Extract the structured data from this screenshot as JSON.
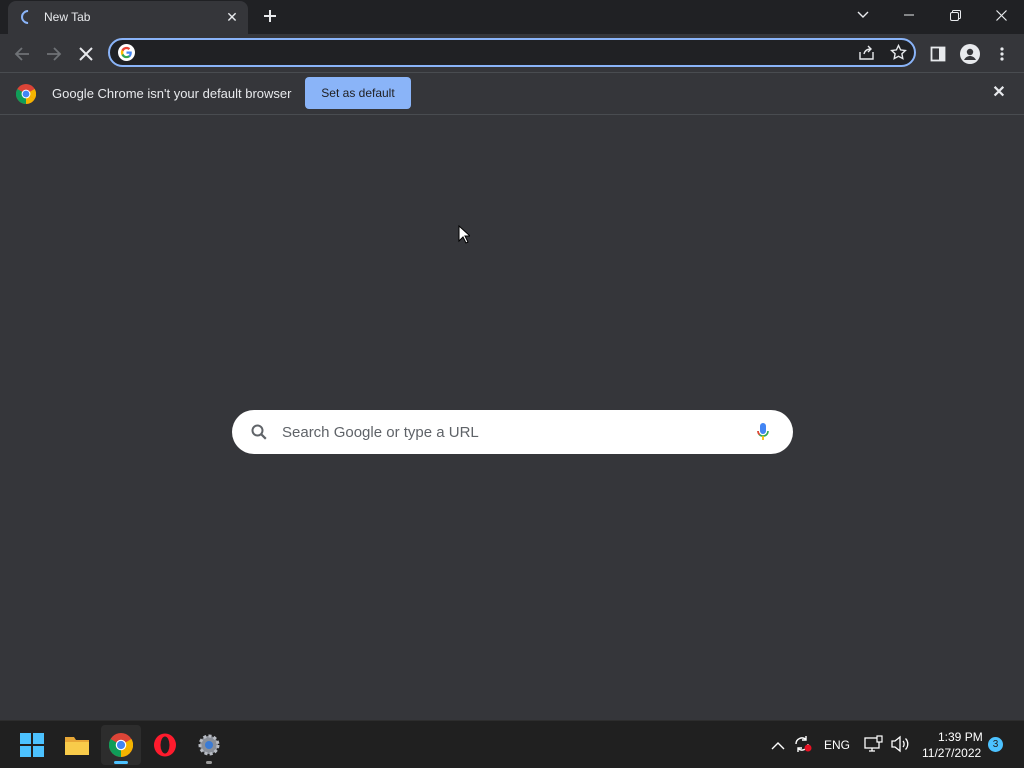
{
  "tab": {
    "title": "New Tab"
  },
  "omnibox": {
    "value": ""
  },
  "infobar": {
    "message": "Google Chrome isn't your default browser",
    "button_label": "Set as default"
  },
  "ntp": {
    "search_placeholder": "Search Google or type a URL"
  },
  "taskbar": {
    "language": "ENG",
    "time": "1:39 PM",
    "date": "11/27/2022",
    "notification_count": "3"
  },
  "colors": {
    "accent": "#8ab4f8",
    "frame": "#202124",
    "toolbar": "#35363a"
  }
}
